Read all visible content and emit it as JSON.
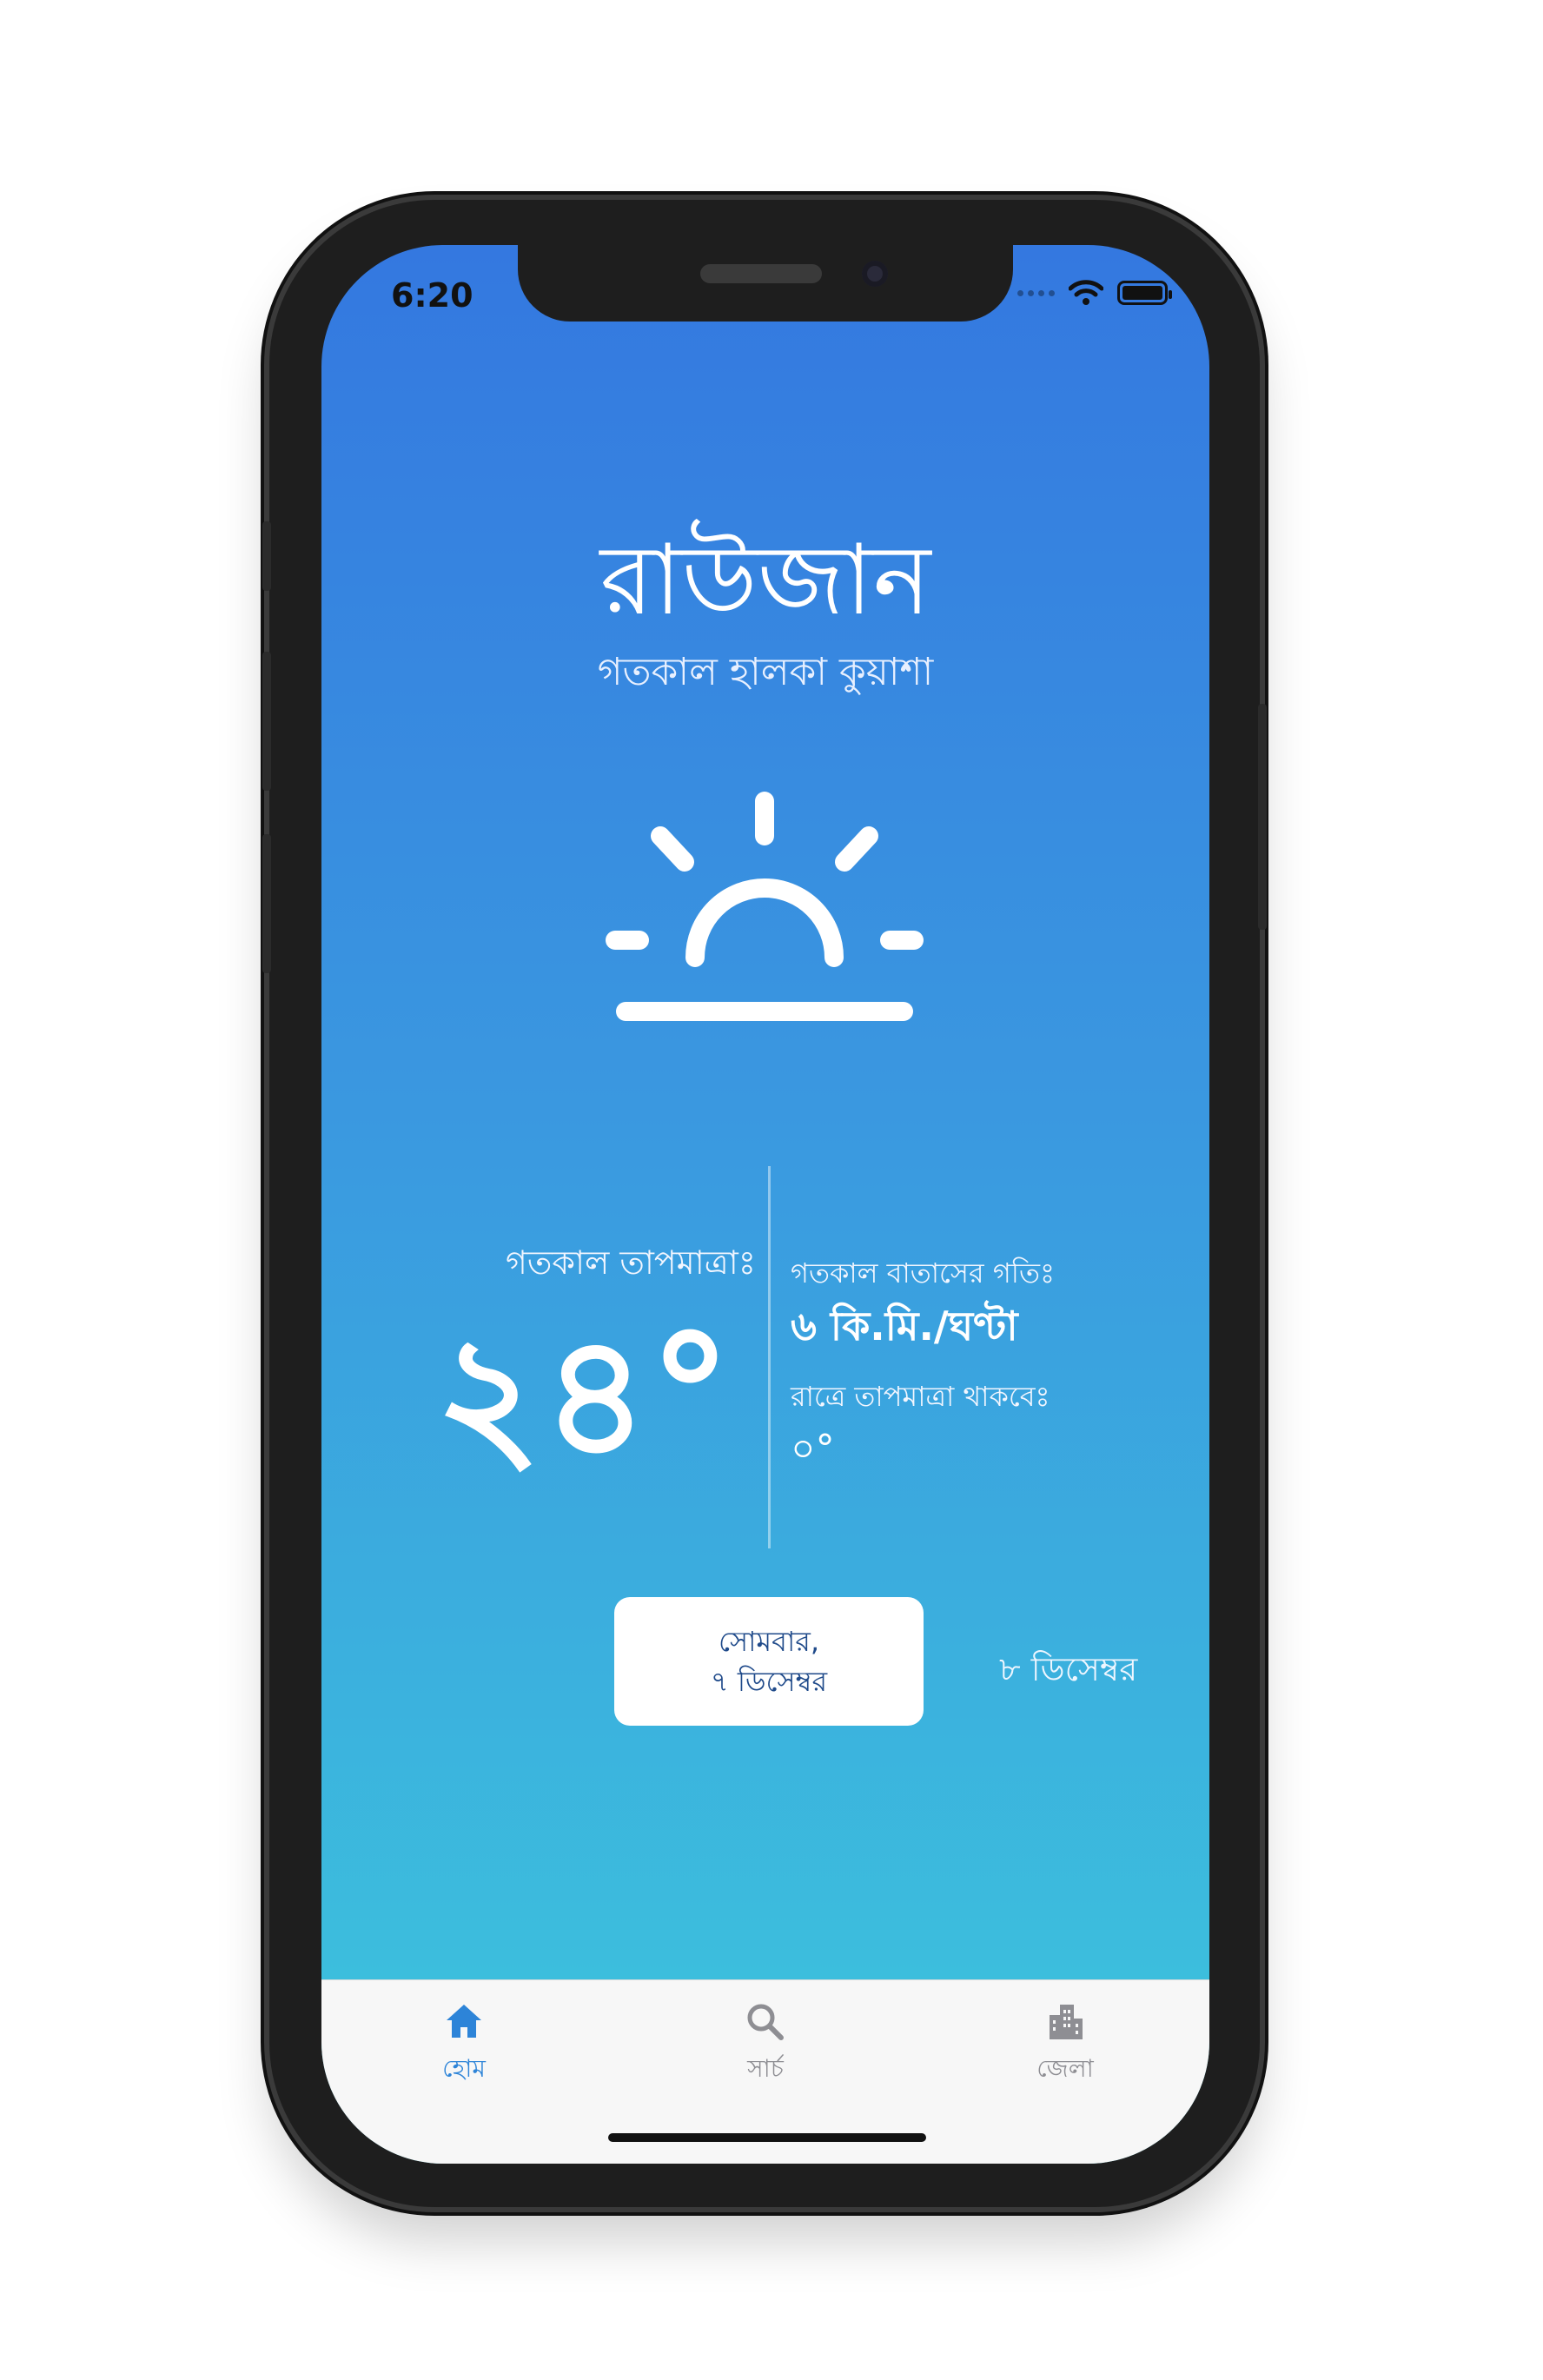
{
  "status_bar": {
    "time": "6:20"
  },
  "weather": {
    "city": "রাউজান",
    "condition": "গতকাল হালকা কুয়াশা",
    "temp_label": "গতকাল তাপমাত্রাঃ",
    "temp_value": "২৪°",
    "wind_label": "গতকাল বাতাসের গতিঃ",
    "wind_value": "৬ কি.মি./ঘণ্টা",
    "night_label": "রাত্রে তাপমাত্রা থাকবেঃ",
    "night_value": "০°",
    "icon": "sunrise-icon"
  },
  "dates": {
    "selected_line1": "সোমবার,",
    "selected_line2": "৭ ডিসেম্বর",
    "next": "৮ ডিসেম্বর"
  },
  "tabbar": {
    "items": [
      {
        "label": "হোম",
        "icon": "home-icon",
        "active": true
      },
      {
        "label": "সার্চ",
        "icon": "search-icon",
        "active": false
      },
      {
        "label": "জেলা",
        "icon": "city-icon",
        "active": false
      }
    ]
  },
  "colors": {
    "gradient_top": "#3478e0",
    "gradient_bottom": "#3cc6dc",
    "accent": "#2d84d8",
    "date_text": "#1f4a8a"
  }
}
